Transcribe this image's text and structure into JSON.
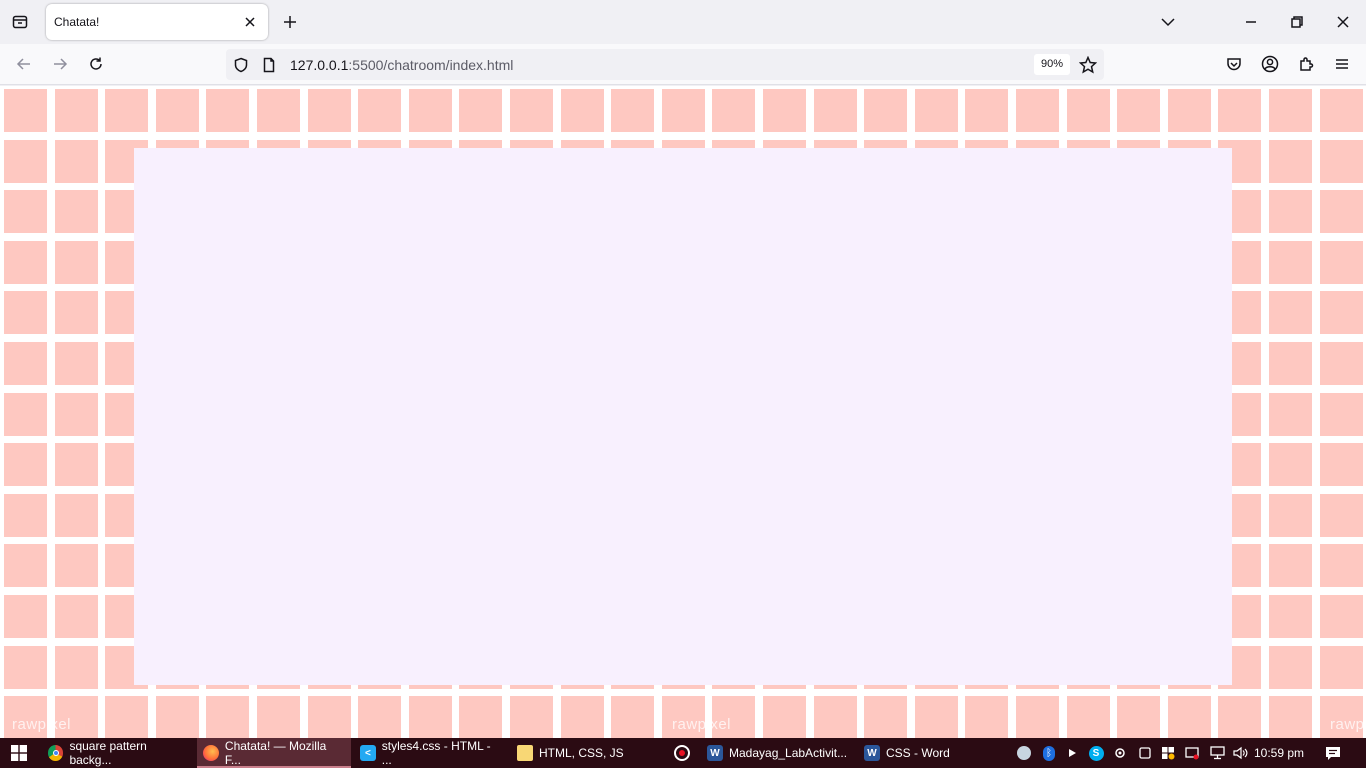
{
  "browser": {
    "tab": {
      "title": "Chatata!"
    },
    "url": {
      "host": "127.0.0.1",
      "rest": ":5500/chatroom/index.html"
    },
    "zoom": "90%"
  },
  "page": {
    "watermark": "rawpixel"
  },
  "taskbar": {
    "items": [
      {
        "label": "square pattern backg...",
        "app": "chrome"
      },
      {
        "label": "Chatata! — Mozilla F...",
        "app": "firefox"
      },
      {
        "label": "styles4.css - HTML - ...",
        "app": "vscode"
      },
      {
        "label": "HTML, CSS, JS",
        "app": "file-explorer"
      },
      {
        "label": "Madayag_LabActivit...",
        "app": "word"
      },
      {
        "label": "CSS - Word",
        "app": "word"
      }
    ],
    "clock": "10:59 pm"
  },
  "colors": {
    "tile": "#fec8c1",
    "panel": "#f8f0fe",
    "taskbar": "#2b0b13"
  }
}
